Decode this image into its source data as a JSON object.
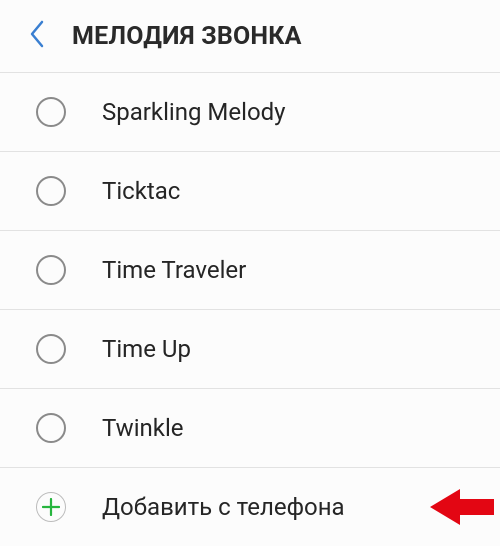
{
  "header": {
    "title": "МЕЛОДИЯ ЗВОНКА"
  },
  "ringtones": [
    {
      "label": "Sparkling Melody",
      "selected": false
    },
    {
      "label": "Ticktac",
      "selected": false
    },
    {
      "label": "Time Traveler",
      "selected": false
    },
    {
      "label": "Time Up",
      "selected": false
    },
    {
      "label": "Twinkle",
      "selected": false
    }
  ],
  "add_from_phone": {
    "label": "Добавить с телефона"
  }
}
